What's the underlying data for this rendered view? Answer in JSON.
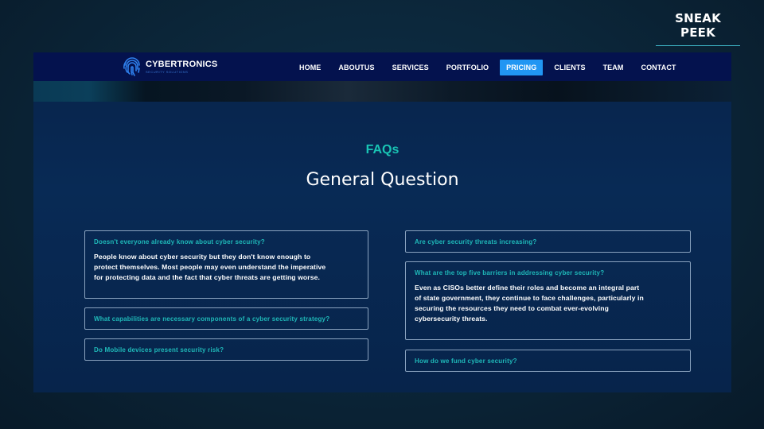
{
  "badge": "SNEAK PEEK",
  "brand": {
    "name": "CYBERTRONICS",
    "tagline": "SECURITY SOLUTIONS"
  },
  "nav": {
    "items": [
      "HOME",
      "ABOUTUS",
      "SERVICES",
      "PORTFOLIO",
      "PRICING",
      "CLIENTS",
      "TEAM",
      "CONTACT"
    ],
    "active": "PRICING"
  },
  "section": {
    "kicker": "FAQs",
    "title": "General Question"
  },
  "faq_left": [
    {
      "question": "Doesn't everyone already know about cyber security?",
      "answer_lines": [
        "People know about cyber security but they don't know enough to",
        "protect themselves. Most people may even understand the imperative",
        "for protecting data and the fact that cyber threats are getting worse."
      ]
    },
    {
      "question": "What capabilities are necessary components of a cyber security strategy?"
    },
    {
      "question": "Do Mobile devices present security risk?"
    }
  ],
  "faq_right": [
    {
      "question": "Are cyber security threats increasing?"
    },
    {
      "question": "What are the top five barriers in addressing cyber security?",
      "answer_lines": [
        "Even as CISOs better define their roles and become an integral part",
        "of state government, they continue to face challenges, particularly in",
        "securing the resources they need to combat ever-evolving",
        "cybersecurity threats."
      ]
    },
    {
      "question": "How do we fund cyber security?"
    }
  ],
  "colors": {
    "accent": "#19c4b4",
    "nav_active": "#2196f3",
    "nav_bg": "#04124e"
  }
}
